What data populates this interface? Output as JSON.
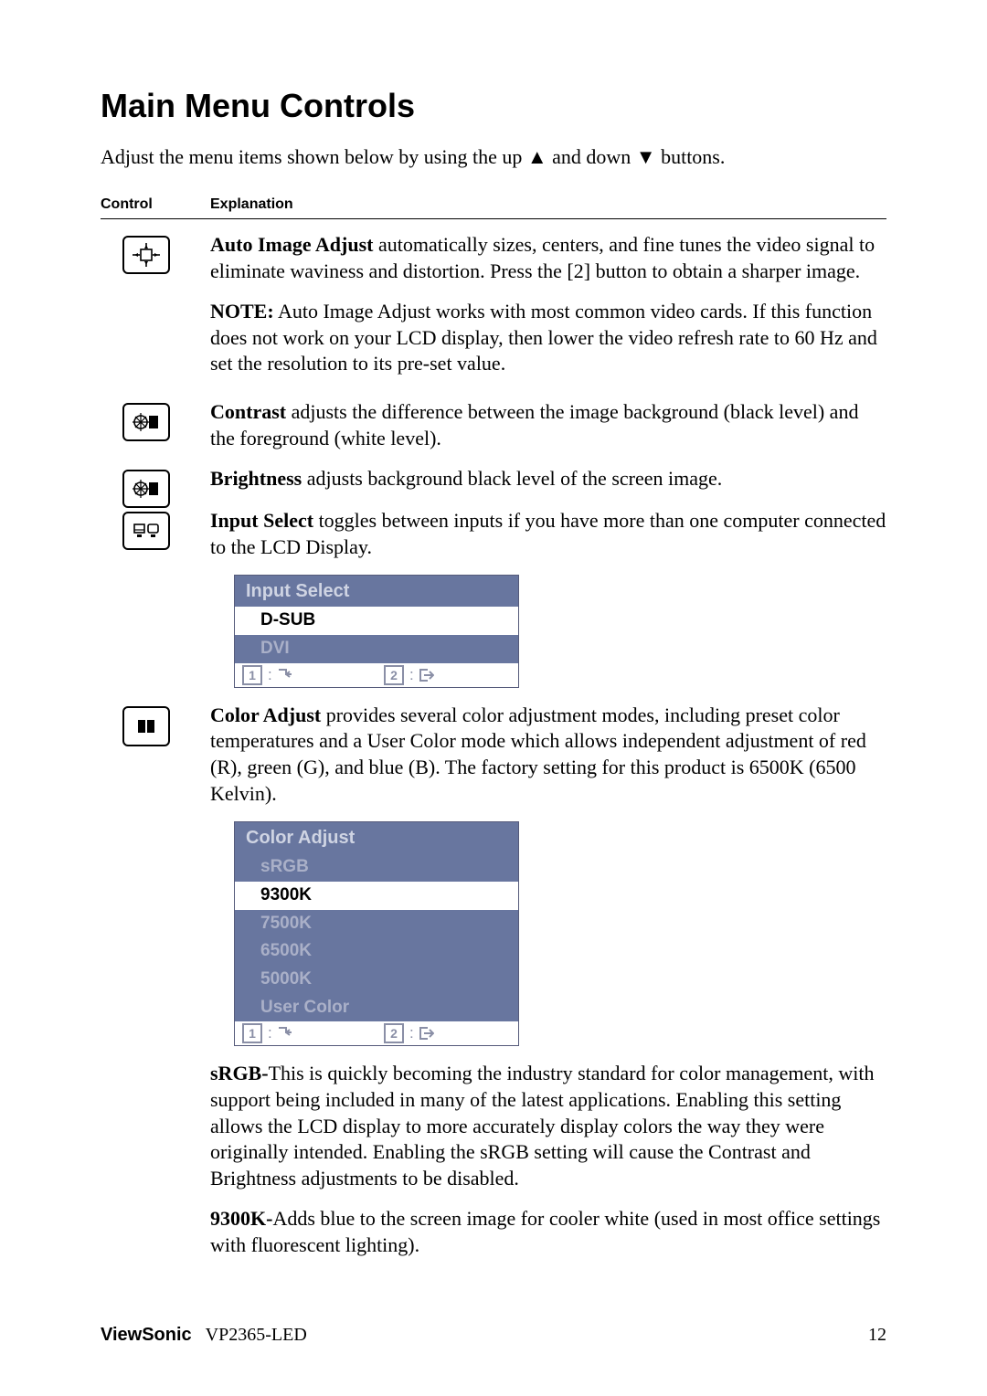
{
  "heading": "Main Menu Controls",
  "intro_prefix": "Adjust the menu items shown below by using the up ",
  "intro_middle": " and down ",
  "intro_suffix": " buttons.",
  "columns": {
    "control": "Control",
    "explanation": "Explanation"
  },
  "items": {
    "auto_image": {
      "title": "Auto Image Adjust",
      "body": " automatically sizes, centers, and fine tunes the video signal to eliminate waviness and distortion. Press the [2] button to obtain a sharper image.",
      "note_label": "NOTE:",
      "note_body": " Auto Image Adjust works with most common video cards. If this function does not work on your LCD display, then lower the video refresh rate to 60 Hz and set the resolution to its pre-set value."
    },
    "contrast": {
      "title": "Contrast",
      "body": " adjusts the difference between the image background  (black level) and the foreground (white level)."
    },
    "brightness": {
      "title": "Brightness",
      "body": " adjusts background black level of the screen image."
    },
    "input_select": {
      "title": "Input Select",
      "body": " toggles between inputs if you have more than one computer connected to the LCD Display."
    },
    "color_adjust": {
      "title": "Color Adjust",
      "body": " provides several color adjustment modes, including preset color temperatures and a User Color mode which allows independent adjustment of red (R), green (G), and blue (B). The factory setting for this product is 6500K (6500 Kelvin)."
    },
    "srgb": {
      "title": "sRGB-",
      "body": "This is quickly becoming the industry standard for color management, with support being included in many of the latest applications. Enabling this setting allows the LCD display to more accurately display colors the way they were originally intended. Enabling the sRGB setting will cause the Contrast and Brightness adjustments to be disabled."
    },
    "k9300": {
      "title": "9300K-",
      "body": "Adds blue to the screen image for cooler white (used in most office settings with fluorescent lighting)."
    }
  },
  "osd": {
    "input_select": {
      "title": "Input Select",
      "items": [
        "D-SUB",
        "DVI"
      ],
      "selected_index": 0,
      "foot": [
        "1",
        "2"
      ]
    },
    "color_adjust": {
      "title": "Color Adjust",
      "items": [
        "sRGB",
        "9300K",
        "7500K",
        "6500K",
        "5000K",
        "User Color"
      ],
      "selected_index": 1,
      "foot": [
        "1",
        "2"
      ]
    }
  },
  "footer": {
    "brand": "ViewSonic",
    "model": "VP2365-LED",
    "page": "12"
  }
}
